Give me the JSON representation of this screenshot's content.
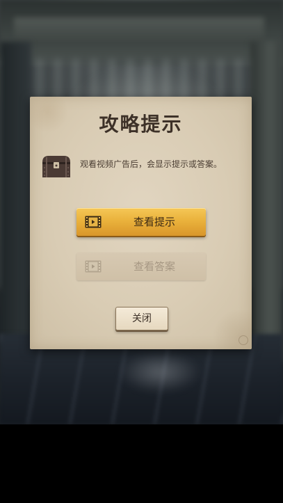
{
  "dialog": {
    "title": "攻略提示",
    "description": "观看视频广告后，会显示提示或答案。",
    "icon": "treasure-chest-icon",
    "buttons": {
      "view_hint_label": "查看提示",
      "view_hint_icon": "video-film-icon",
      "view_answer_label": "查看答案",
      "view_answer_icon": "video-film-icon",
      "view_answer_enabled": false,
      "close_label": "关闭"
    }
  },
  "colors": {
    "panel": "#dcd0b8",
    "primary_button": "#eab23c",
    "disabled_button": "#cfc0a7",
    "text_dark": "#3d3128"
  }
}
